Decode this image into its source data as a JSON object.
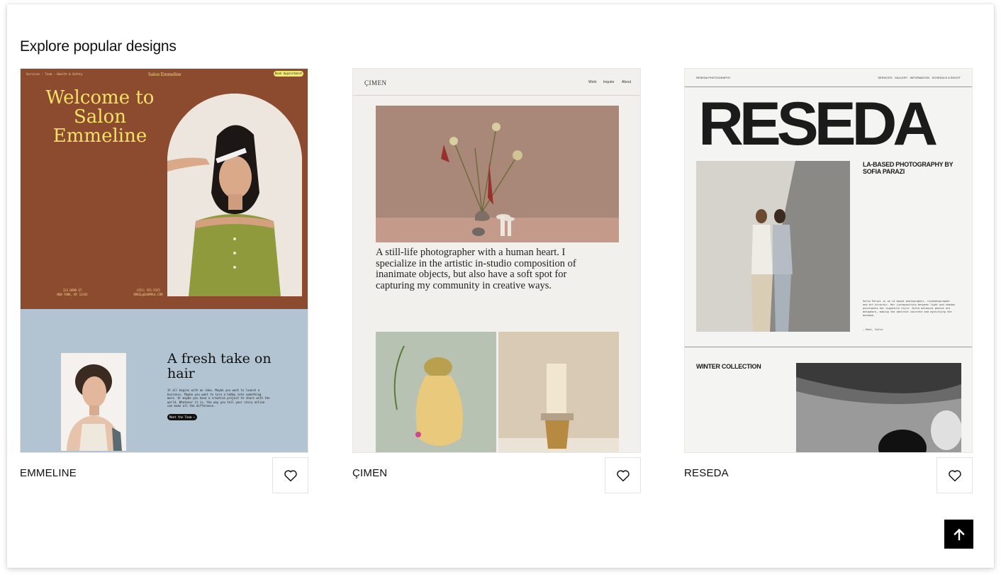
{
  "section": {
    "title": "Explore popular designs"
  },
  "cards": [
    {
      "name": "EMMELINE",
      "preview": {
        "nav_left": "Services · Team · Health & Safety",
        "nav_center": "Salon Emmeline",
        "nav_button": "Book Appointment",
        "headline": "Welcome to Salon Emmeline",
        "address": "123 DEMO ST\nNEW YORK, NY 12345",
        "phone": "(555) 555-5555\nEMAIL@EXAMPLE.COM",
        "fresh": "A fresh take on hair",
        "body": "It all begins with an idea. Maybe you want to launch a business. Maybe you want to turn a hobby into something more. Or maybe you have a creative project to share with the world. Whatever it is, the way you tell your story online can make all the difference.",
        "button": "Meet the Team →"
      }
    },
    {
      "name": "ÇIMEN",
      "preview": {
        "logo": "ÇIMEN",
        "menu": [
          "Work",
          "Inquire",
          "About"
        ],
        "text": "A still-life photographer with a human heart. I specialize in the artistic in-studio composition of inanimate objects, but also have a soft spot for capturing my community in creative ways."
      }
    },
    {
      "name": "RESEDA",
      "preview": {
        "nav_left": "RESEDA PHOTOGRAPHY",
        "nav_right": "SERVICES   GALLERY   INFORMATION   SCHEDULE A SHOOT",
        "title": "RESEDA",
        "subtitle": "LA-BASED PHOTOGRAPHY BY SOFIA PARAZI",
        "small": "Sofia Parazi is an LA based photographer, cinematographer and art director. Her juxtaposition between light and shadow punctuates her signature style. Sofia balances photos are metaphors, making the abstract concrete and mystifying the mundane.",
        "signature": "— Best, Sofia",
        "winter": "WINTER COLLECTION"
      }
    }
  ],
  "icons": {
    "favorite": "heart-outline-icon",
    "back_to_top": "arrow-up-icon"
  }
}
